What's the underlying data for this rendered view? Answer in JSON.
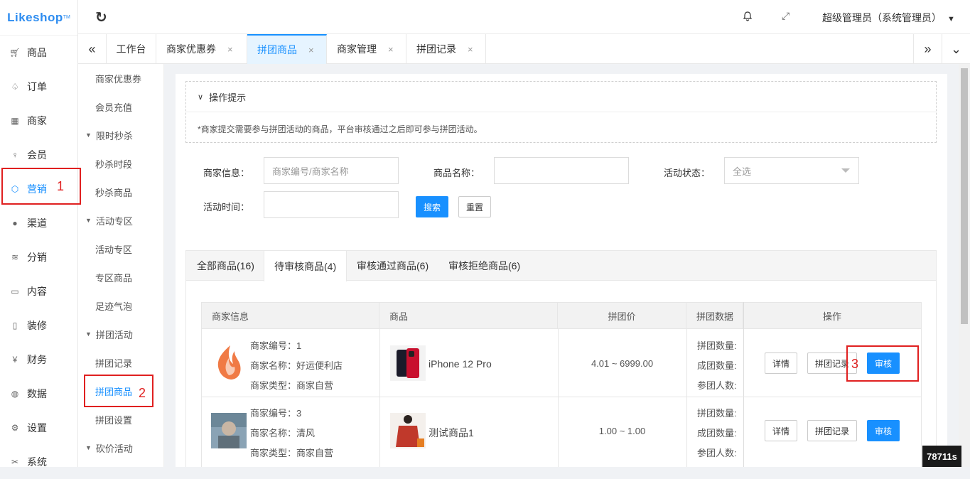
{
  "logo": {
    "text": "Likeshop",
    "tm": "TM"
  },
  "nav": [
    {
      "label": "商品",
      "icon": "cart-icon"
    },
    {
      "label": "订单",
      "icon": "bell-icon"
    },
    {
      "label": "商家",
      "icon": "shop-icon"
    },
    {
      "label": "会员",
      "icon": "user-icon"
    },
    {
      "label": "营销",
      "icon": "cube-icon"
    },
    {
      "label": "渠道",
      "icon": "channel-icon"
    },
    {
      "label": "分销",
      "icon": "layers-icon"
    },
    {
      "label": "内容",
      "icon": "book-icon"
    },
    {
      "label": "装修",
      "icon": "tablet-icon"
    },
    {
      "label": "财务",
      "icon": "yen-icon"
    },
    {
      "label": "数据",
      "icon": "globe-icon"
    },
    {
      "label": "设置",
      "icon": "gear-icon"
    },
    {
      "label": "系统",
      "icon": "tools-icon"
    }
  ],
  "submenu": [
    {
      "label": "商家优惠券",
      "type": "item"
    },
    {
      "label": "会员充值",
      "type": "item"
    },
    {
      "label": "限时秒杀",
      "type": "group"
    },
    {
      "label": "秒杀时段",
      "type": "item"
    },
    {
      "label": "秒杀商品",
      "type": "item"
    },
    {
      "label": "活动专区",
      "type": "group"
    },
    {
      "label": "活动专区",
      "type": "item"
    },
    {
      "label": "专区商品",
      "type": "item"
    },
    {
      "label": "足迹气泡",
      "type": "item"
    },
    {
      "label": "拼团活动",
      "type": "group"
    },
    {
      "label": "拼团记录",
      "type": "item"
    },
    {
      "label": "拼团商品",
      "type": "item"
    },
    {
      "label": "拼团设置",
      "type": "item"
    },
    {
      "label": "砍价活动",
      "type": "group"
    }
  ],
  "topbar": {
    "user": "超级管理员（系统管理员）"
  },
  "tabs": [
    {
      "label": "工作台"
    },
    {
      "label": "商家优惠券"
    },
    {
      "label": "拼团商品"
    },
    {
      "label": "商家管理"
    },
    {
      "label": "拼团记录"
    }
  ],
  "tips": {
    "title": "操作提示",
    "text": "*商家提交需要参与拼团活动的商品，平台审核通过之后即可参与拼团活动。"
  },
  "filters": {
    "merchant_label": "商家信息：",
    "merchant_placeholder": "商家编号/商家名称",
    "goods_label": "商品名称：",
    "status_label": "活动状态：",
    "status_value": "全选",
    "time_label": "活动时间：",
    "search_btn": "搜索",
    "reset_btn": "重置"
  },
  "status_tabs": [
    "全部商品(16)",
    "待审核商品(4)",
    "审核通过商品(6)",
    "审核拒绝商品(6)"
  ],
  "table": {
    "headers": [
      "商家信息",
      "商品",
      "拼团价",
      "拼团数据",
      "操作"
    ],
    "rows": [
      {
        "merchant_no": "商家编号：1",
        "merchant_name": "商家名称：好运便利店",
        "merchant_type": "商家类型：商家自营",
        "goods": "iPhone 12 Pro",
        "price": "4.01 ~ 6999.00",
        "data1": "拼团数量:",
        "data2": "成团数量:",
        "data3": "参团人数:",
        "btn_detail": "详情",
        "btn_record": "拼团记录",
        "btn_audit": "审核"
      },
      {
        "merchant_no": "商家编号：3",
        "merchant_name": "商家名称：清风",
        "merchant_type": "商家类型：商家自营",
        "goods": "测试商品1",
        "price": "1.00 ~ 1.00",
        "data1": "拼团数量:",
        "data2": "成团数量:",
        "data3": "参团人数:",
        "btn_detail": "详情",
        "btn_record": "拼团记录",
        "btn_audit": "审核"
      }
    ]
  },
  "annotations": [
    "1",
    "2",
    "3"
  ],
  "corner_badge": "78711s",
  "colors": {
    "primary": "#1890ff",
    "annotation": "#e02020"
  }
}
